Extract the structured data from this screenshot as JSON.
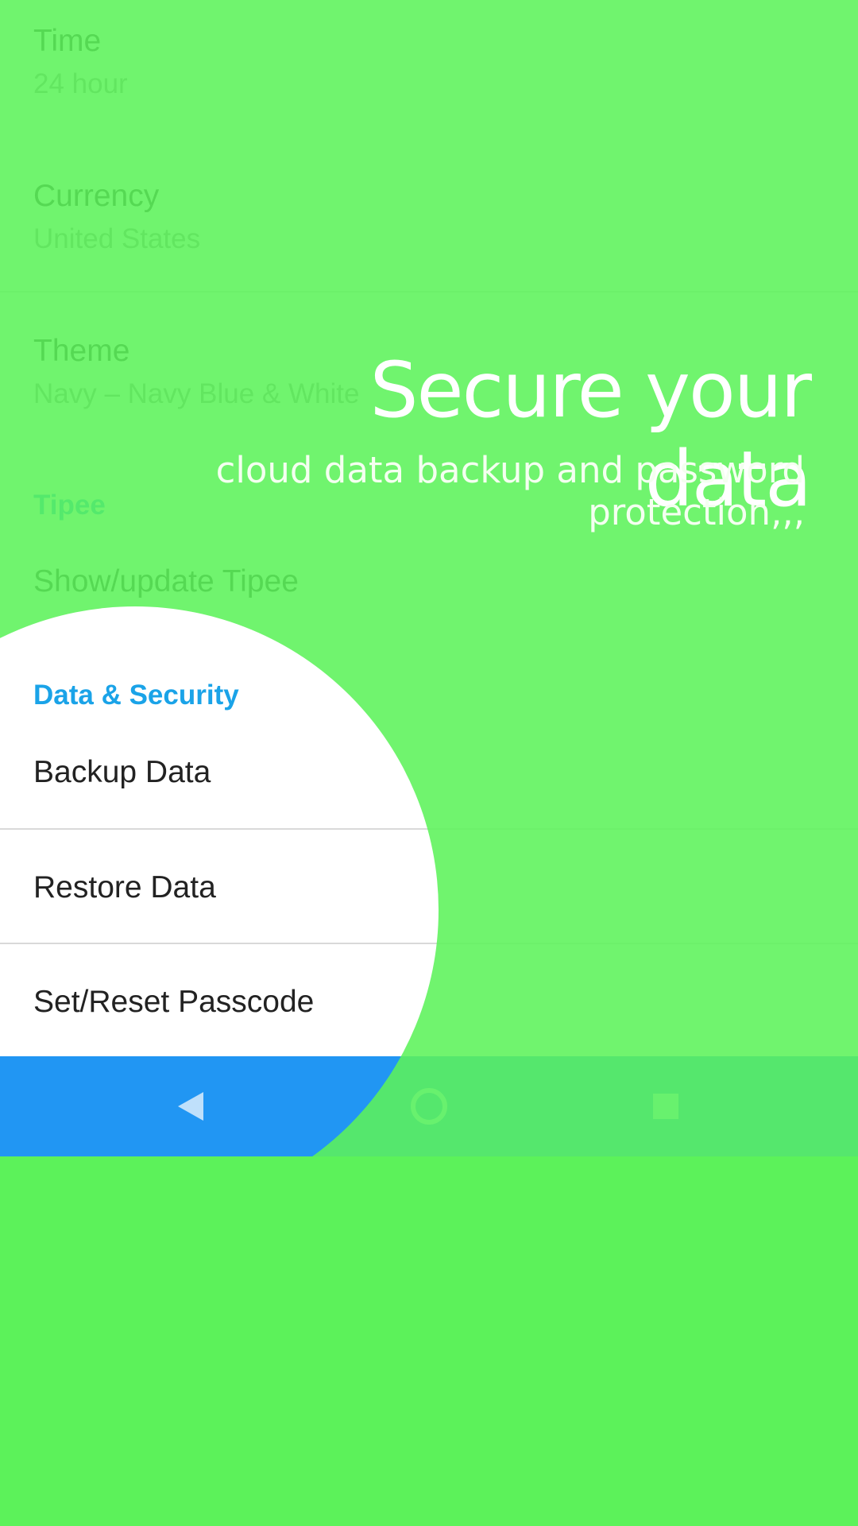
{
  "settings": {
    "time": {
      "title": "Time",
      "value": "24 hour"
    },
    "currency": {
      "title": "Currency",
      "value": "United States"
    },
    "theme": {
      "title": "Theme",
      "value": "Navy – Navy Blue & White"
    },
    "tipee_header": "Tipee",
    "tipee_item": "Show/update Tipee",
    "data_security_header": "Data & Security",
    "backup": "Backup Data",
    "restore": "Restore Data",
    "passcode": "Set/Reset Passcode"
  },
  "onboarding": {
    "headline": "Secure your data",
    "subhead": "cloud data backup and password protection,,,"
  },
  "colors": {
    "overlay_green": "#5cf25a",
    "accent_blue": "#1aa3e8",
    "nav_blue": "#2196f3"
  },
  "navbar": {
    "back_icon": "back-triangle-icon",
    "home_icon": "home-circle-icon",
    "recents_icon": "recents-square-icon"
  }
}
